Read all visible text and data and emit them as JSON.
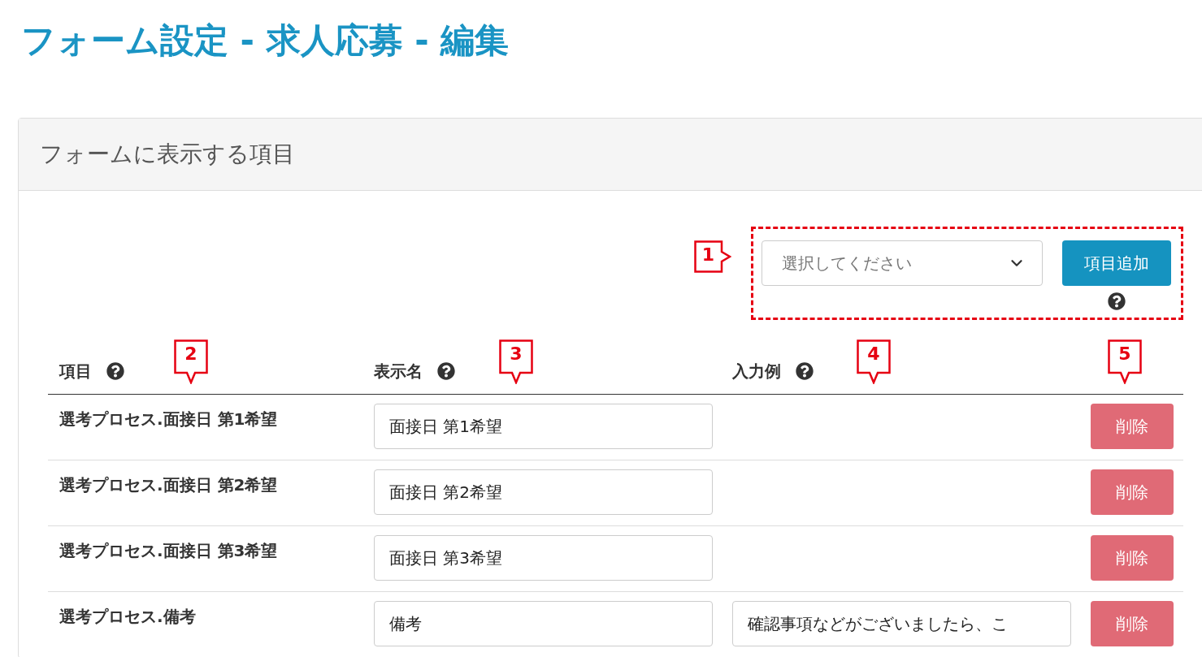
{
  "title": "フォーム設定 - 求人応募 - 編集",
  "card": {
    "title": "フォームに表示する項目"
  },
  "add_bar": {
    "select": {
      "placeholder": "選択してください"
    },
    "button": "項目追加",
    "callout": "1"
  },
  "table": {
    "columns": [
      {
        "label": "項目",
        "callout": "2"
      },
      {
        "label": "表示名",
        "callout": "3"
      },
      {
        "label": "入力例",
        "callout": "4"
      },
      {
        "callout": "5"
      }
    ],
    "rows": [
      {
        "item": "選考プロセス.面接日 第1希望",
        "display_name": "面接日 第1希望",
        "delete": "削除"
      },
      {
        "item": "選考プロセス.面接日 第2希望",
        "display_name": "面接日 第2希望",
        "delete": "削除"
      },
      {
        "item": "選考プロセス.面接日 第3希望",
        "display_name": "面接日 第3希望",
        "delete": "削除"
      },
      {
        "item": "選考プロセス.備考",
        "display_name": "備考",
        "example": "確認事項などがございましたら、こ",
        "delete": "削除"
      }
    ]
  }
}
